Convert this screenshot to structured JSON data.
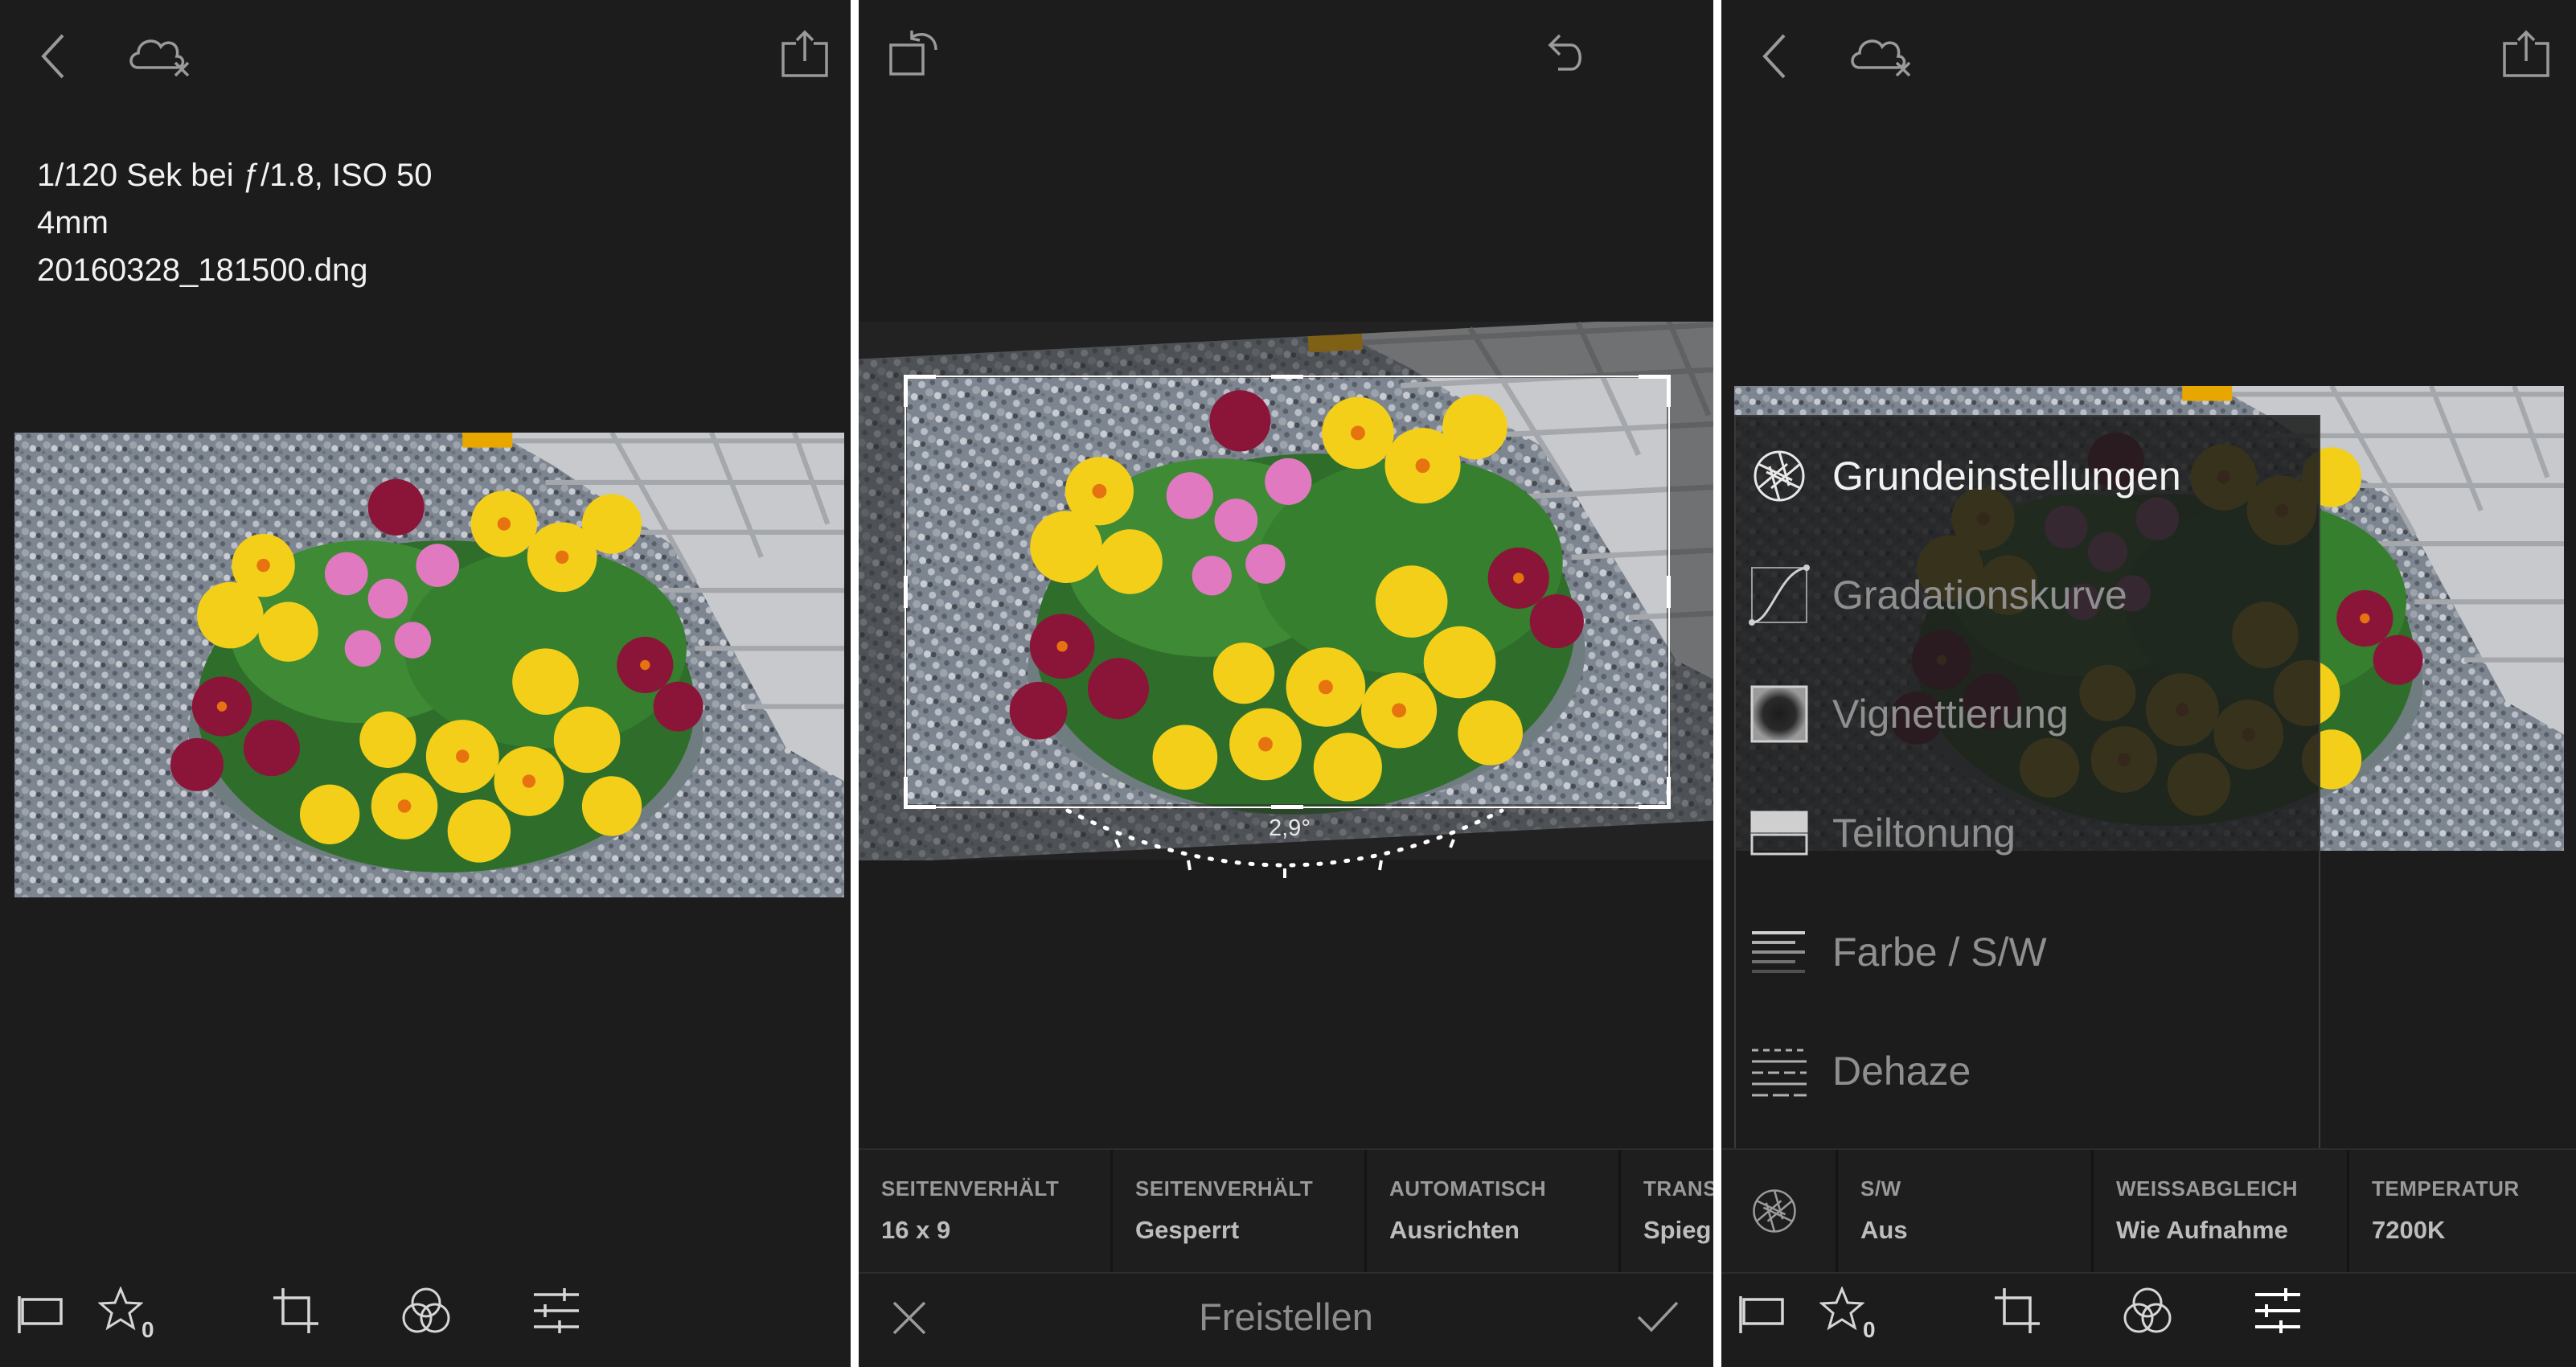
{
  "panel1": {
    "info_lines": [
      "1/120 Sek bei ƒ/1.8, ISO 50",
      "4mm",
      "20160328_181500.dng"
    ],
    "icons": [
      "back-icon",
      "cloud-off-icon",
      "share-icon"
    ],
    "bottom": {
      "rating_count": "0",
      "icons": [
        "flag-icon",
        "star-icon",
        "crop-icon",
        "color-circles-icon",
        "sliders-icon"
      ]
    }
  },
  "panel2": {
    "icons": [
      "rotate-icon",
      "undo-icon"
    ],
    "angle_label": "2,9°",
    "tools": [
      {
        "label": "SEITENVERHÄLT",
        "value": "16 x 9"
      },
      {
        "label": "SEITENVERHÄLT",
        "value": "Gesperrt"
      },
      {
        "label": "AUTOMATISCH",
        "value": "Ausrichten"
      },
      {
        "label": "TRANS",
        "value": "Spieg"
      }
    ],
    "title": "Freistellen",
    "bottom_icons": [
      "cancel-icon",
      "confirm-icon"
    ]
  },
  "panel3": {
    "icons": [
      "back-icon",
      "cloud-off-icon",
      "share-icon"
    ],
    "menu": [
      {
        "label": "Grundeinstellungen",
        "icon": "aperture-icon",
        "active": true
      },
      {
        "label": "Gradationskurve",
        "icon": "curve-icon",
        "active": false
      },
      {
        "label": "Vignettierung",
        "icon": "vignette-icon",
        "active": false
      },
      {
        "label": "Teiltonung",
        "icon": "split-toning-icon",
        "active": false
      },
      {
        "label": "Farbe / S/W",
        "icon": "color-bw-icon",
        "active": false
      },
      {
        "label": "Dehaze",
        "icon": "dehaze-icon",
        "active": false
      }
    ],
    "tools": [
      {
        "label": "S/W",
        "value": "Aus"
      },
      {
        "label": "WEISSABGLEICH",
        "value": "Wie Aufnahme"
      },
      {
        "label": "TEMPERATUR",
        "value": "7200K"
      }
    ],
    "bottom": {
      "rating_count": "0"
    }
  },
  "colors": {
    "background": "#1c1c1c",
    "text": "#e8e8e8",
    "muted": "#9a9a9a",
    "accent_yellow": "#f5d400",
    "magenta": "#c2185b"
  }
}
